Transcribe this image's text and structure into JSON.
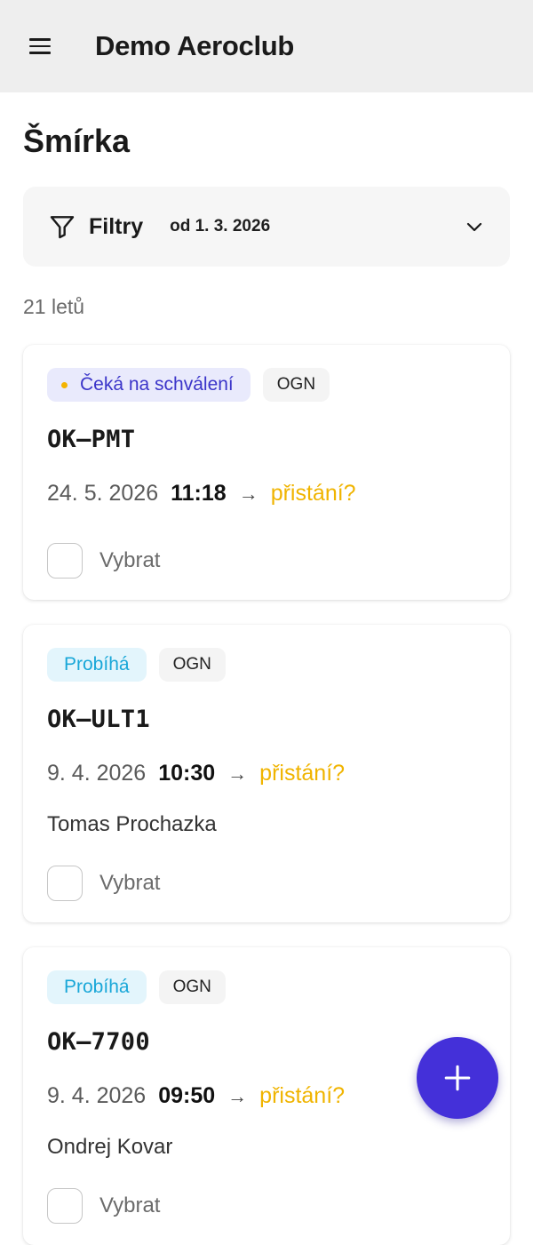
{
  "appbar": {
    "title": "Demo Aeroclub",
    "menu_icon": "hamburger-menu-icon"
  },
  "page": {
    "title": "Šmírka"
  },
  "filters": {
    "label": "Filtry",
    "value": "od 1. 3. 2026",
    "icon": "filter-funnel-icon",
    "toggle_icon": "chevron-down-icon"
  },
  "summary": {
    "count": "21 letů"
  },
  "flights": [
    {
      "status": "Čeká na schválení",
      "status_type": "pending",
      "source": "OGN",
      "registration": "OK–PMT",
      "date": "24. 5. 2026",
      "time": "11:18",
      "arrow": "→",
      "landing": "přistání?",
      "pilot": "",
      "select_label": "Vybrat"
    },
    {
      "status": "Probíhá",
      "status_type": "running",
      "source": "OGN",
      "registration": "OK–ULT1",
      "date": "9. 4. 2026",
      "time": "10:30",
      "arrow": "→",
      "landing": "přistání?",
      "pilot": "Tomas Prochazka",
      "select_label": "Vybrat"
    },
    {
      "status": "Probíhá",
      "status_type": "running",
      "source": "OGN",
      "registration": "OK–7700",
      "date": "9. 4. 2026",
      "time": "09:50",
      "arrow": "→",
      "landing": "přistání?",
      "pilot": "Ondrej Kovar",
      "select_label": "Vybrat"
    }
  ],
  "fab": {
    "icon": "plus-icon"
  },
  "colors": {
    "accent": "#4430d9",
    "pending_text": "#3b35c9",
    "running_text": "#19a7d8",
    "landing_text": "#f0b400"
  }
}
